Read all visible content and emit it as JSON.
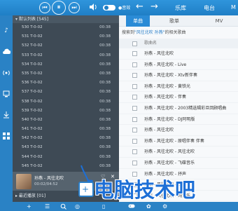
{
  "topbar": {
    "controls": {
      "prev": "⏮",
      "play": "⏸",
      "next": "⏭"
    },
    "icons": [
      "volume-icon"
    ],
    "status": "●音效",
    "back": "←",
    "forward": "→",
    "tabs": [
      "乐库",
      "电台",
      "M"
    ]
  },
  "left_icons": [
    "music-note-icon",
    "cloud-icon",
    "radio-icon",
    "device-icon",
    "download-icon",
    "apps-icon"
  ],
  "playlist": {
    "header": "默认列表 [545]",
    "tracks": [
      {
        "name": "530  T-0-02",
        "time": "00:38"
      },
      {
        "name": "531  T-0-02",
        "time": "00:38"
      },
      {
        "name": "532  T-0-02",
        "time": "00:38"
      },
      {
        "name": "533  T-0-02",
        "time": "00:38"
      },
      {
        "name": "534  T-0-02",
        "time": "00:38"
      },
      {
        "name": "535  T-0-02",
        "time": "00:38"
      },
      {
        "name": "536  T-0-02",
        "time": "00:38"
      },
      {
        "name": "537  T-0-02",
        "time": "00:38"
      },
      {
        "name": "538  T-0-02",
        "time": "00:38"
      },
      {
        "name": "539  T-0-02",
        "time": "00:38"
      },
      {
        "name": "540  T-0-02",
        "time": "00:38"
      },
      {
        "name": "541  T-0-02",
        "time": "00:38"
      },
      {
        "name": "542  T-0-02",
        "time": "00:38"
      },
      {
        "name": "543  T-0-02",
        "time": "00:38"
      },
      {
        "name": "544  T-0-02",
        "time": "00:38"
      },
      {
        "name": "545  T-0-02",
        "time": "00:38"
      }
    ]
  },
  "now_playing": {
    "title": "孙燕 - 风往北吹",
    "meta": "00:02/04:52"
  },
  "recent": "最近播放 [01]",
  "right": {
    "tabs": [
      "单曲",
      "歌单",
      "MV"
    ],
    "search_prefix": "搜索到",
    "search_keyword": "\"风往北吹 孙燕\"",
    "search_suffix": "的相关歌曲",
    "column": "歌曲名",
    "results": [
      "孙燕 - 风往北吹",
      "孙燕 - 风往北吹 - Live",
      "孙燕 - 风往北吹 - Xtv新伴奏",
      "孙燕 - 风往北吹 - 黄铁光",
      "孙燕 - 风往北吹 - 伴奏",
      "孙燕 - 风往北吹 - 2003精选辑彩旦回顾唱曲",
      "孙燕 - 风往北吹 - DJ阿明版",
      "孙燕 - 风往北吹",
      "孙燕 - 风往北吹 - 原唱伴奏 伴奏",
      "孙燕 - 风往北吹 - 风往北吹",
      "孙燕 - 风往北吹 - 飞碟音乐",
      "孙燕 - 风往北吹 - 抒声",
      "孙燕 - 风往北吹 - DJ",
      "孙燕 - 风往北吹 - 纯音乐"
    ]
  },
  "bottom_icons": [
    "add-icon",
    "list-icon",
    "search-icon",
    "locate-icon",
    "phone-icon",
    "gamepad-icon",
    "skin-icon",
    "settings-icon"
  ],
  "watermark": "电脑技术吧",
  "colors": {
    "accent": "#2a82c5",
    "playlist_bg": "#3e4a55",
    "watermark": "#1d6fd6"
  }
}
